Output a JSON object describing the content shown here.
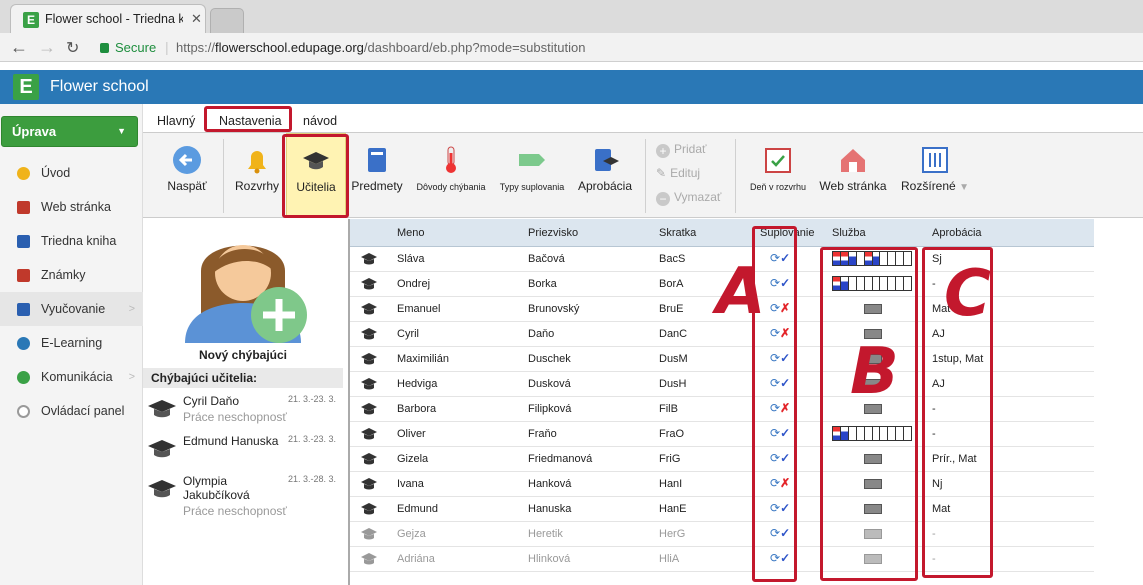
{
  "browser": {
    "tab_title": "Flower school - Triedna k",
    "tab_favicon": "E",
    "secure_label": "Secure",
    "url_scheme": "https://",
    "url_host": "flowerschool.edupage.org",
    "url_path": "/dashboard/eb.php?mode=substitution"
  },
  "app": {
    "logo_letter": "E",
    "name": "Flower school",
    "brand_color": "#2a78b6"
  },
  "sidebar": {
    "edit_button": "Úprava",
    "items": [
      {
        "label": "Úvod",
        "icon": "star-icon",
        "color": "#f0b31a"
      },
      {
        "label": "Web stránka",
        "icon": "house-icon",
        "color": "#c0392b"
      },
      {
        "label": "Triedna kniha",
        "icon": "book-icon",
        "color": "#2a5fb0"
      },
      {
        "label": "Známky",
        "icon": "grades-icon",
        "color": "#c0392b"
      },
      {
        "label": "Vyučovanie",
        "icon": "teaching-icon",
        "color": "#2a5fb0"
      },
      {
        "label": "E-Learning",
        "icon": "globe-icon",
        "color": "#2a78b6"
      },
      {
        "label": "Komunikácia",
        "icon": "globe-chat-icon",
        "color": "#3aa146"
      },
      {
        "label": "Ovládací panel",
        "icon": "gear-icon",
        "color": "#9a9a9a"
      }
    ]
  },
  "toptabs": [
    "Hlavný",
    "Nastavenia",
    "návod"
  ],
  "ribbon": {
    "buttons": [
      "Naspäť",
      "Rozvrhy",
      "Učitelia",
      "Predmety",
      "Dôvody chýbania",
      "Typy suplovania",
      "Aprobácia"
    ],
    "mini": [
      "Pridať",
      "Edituj",
      "Vymazať"
    ],
    "right_buttons": [
      "Deň v rozvrhu",
      "Web stránka",
      "Rozšírené"
    ]
  },
  "left_panel": {
    "new_absent_label": "Nový chýbajúci",
    "absent_header": "Chýbajúci učitelia:",
    "absent": [
      {
        "name": "Cyril Daňo",
        "dates": "21. 3.-23. 3.",
        "reason": "Práce neschopnosť"
      },
      {
        "name": "Edmund Hanuska",
        "dates": "21. 3.-23. 3.",
        "reason": ""
      },
      {
        "name": "Olympia Jakubčíková",
        "dates": "21. 3.-28. 3.",
        "reason": "Práce neschopnosť"
      }
    ]
  },
  "table": {
    "headers": [
      "Meno",
      "Priezvisko",
      "Skratka",
      "Suplovanie",
      "Služba",
      "Aprobácia"
    ],
    "rows": [
      {
        "meno": "Sláva",
        "priezvisko": "Bačová",
        "skratka": "BacS",
        "sup": "ok",
        "sluzba": "grid1",
        "aprobacia": "Sj"
      },
      {
        "meno": "Ondrej",
        "priezvisko": "Borka",
        "skratka": "BorA",
        "sup": "ok",
        "sluzba": "grid2",
        "aprobacia": "-"
      },
      {
        "meno": "Emanuel",
        "priezvisko": "Brunovský",
        "skratka": "BruE",
        "sup": "no",
        "sluzba": "small",
        "aprobacia": "Mat"
      },
      {
        "meno": "Cyril",
        "priezvisko": "Daňo",
        "skratka": "DanC",
        "sup": "no",
        "sluzba": "small",
        "aprobacia": "AJ"
      },
      {
        "meno": "Maximilián",
        "priezvisko": "Duschek",
        "skratka": "DusM",
        "sup": "ok",
        "sluzba": "small",
        "aprobacia": "1stup, Mat"
      },
      {
        "meno": "Hedviga",
        "priezvisko": "Dusková",
        "skratka": "DusH",
        "sup": "ok",
        "sluzba": "small",
        "aprobacia": "AJ"
      },
      {
        "meno": "Barbora",
        "priezvisko": "Filipková",
        "skratka": "FilB",
        "sup": "no",
        "sluzba": "small",
        "aprobacia": "-"
      },
      {
        "meno": "Oliver",
        "priezvisko": "Fraňo",
        "skratka": "FraO",
        "sup": "ok",
        "sluzba": "grid3",
        "aprobacia": "-"
      },
      {
        "meno": "Gizela",
        "priezvisko": "Friedmanová",
        "skratka": "FriG",
        "sup": "ok",
        "sluzba": "small",
        "aprobacia": "Prír., Mat"
      },
      {
        "meno": "Ivana",
        "priezvisko": "Hanková",
        "skratka": "HanI",
        "sup": "no",
        "sluzba": "small",
        "aprobacia": "Nj"
      },
      {
        "meno": "Edmund",
        "priezvisko": "Hanuska",
        "skratka": "HanE",
        "sup": "ok",
        "sluzba": "small",
        "aprobacia": "Mat"
      },
      {
        "meno": "Gejza",
        "priezvisko": "Heretik",
        "skratka": "HerG",
        "sup": "ok",
        "sluzba": "small",
        "aprobacia": "-",
        "faded": true
      },
      {
        "meno": "Adriána",
        "priezvisko": "Hlinková",
        "skratka": "HliA",
        "sup": "ok",
        "sluzba": "small",
        "aprobacia": "-",
        "faded": true
      }
    ]
  },
  "annotations": {
    "a": "A",
    "b": "B",
    "c": "C",
    "color": "#c3182d"
  }
}
